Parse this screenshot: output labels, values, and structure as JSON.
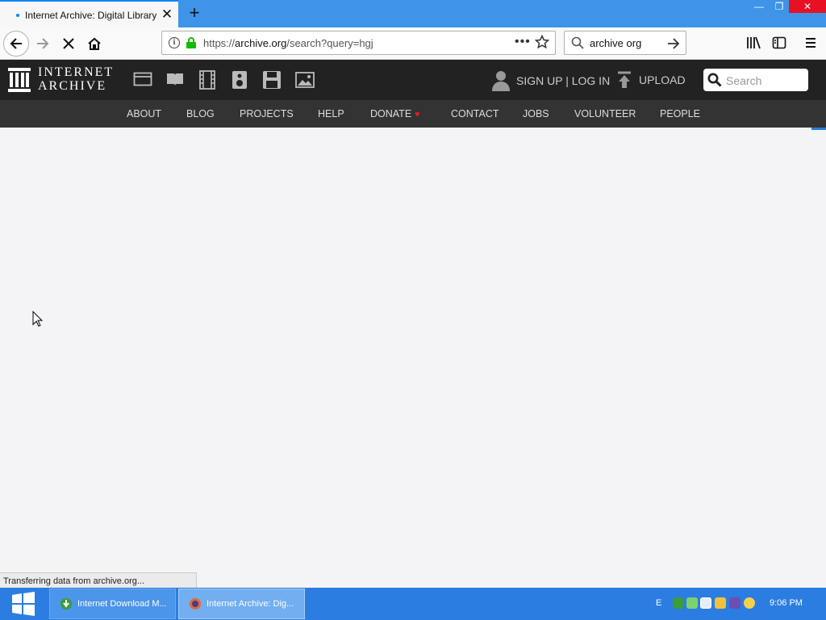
{
  "browser": {
    "tab_title": "Internet Archive: Digital Library of F",
    "url_prefix": "https://",
    "url_host": "archive.org",
    "url_path": "/search?query=hgj",
    "search_value": "archive org",
    "status_text": "Transferring data from archive.org..."
  },
  "site": {
    "logo_line1": "INTERNET",
    "logo_line2": "ARCHIVE",
    "signin_label": "SIGN UP | LOG IN",
    "upload_label": "UPLOAD",
    "search_placeholder": "Search",
    "nav": [
      "ABOUT",
      "BLOG",
      "PROJECTS",
      "HELP",
      "DONATE",
      "CONTACT",
      "JOBS",
      "VOLUNTEER",
      "PEOPLE"
    ],
    "media_icons": [
      "web-icon",
      "texts-icon",
      "video-icon",
      "audio-icon",
      "software-icon",
      "images-icon"
    ]
  },
  "taskbar": {
    "tasks": [
      "Internet Download M...",
      "Internet Archive: Dig..."
    ],
    "clock": "9:06 PM",
    "tray_letter": "E"
  },
  "colors": {
    "tabbar": "#3d94e8",
    "header": "#222222",
    "nav": "#333333",
    "taskbar": "#2b7de1",
    "heart": "#e31b23"
  }
}
